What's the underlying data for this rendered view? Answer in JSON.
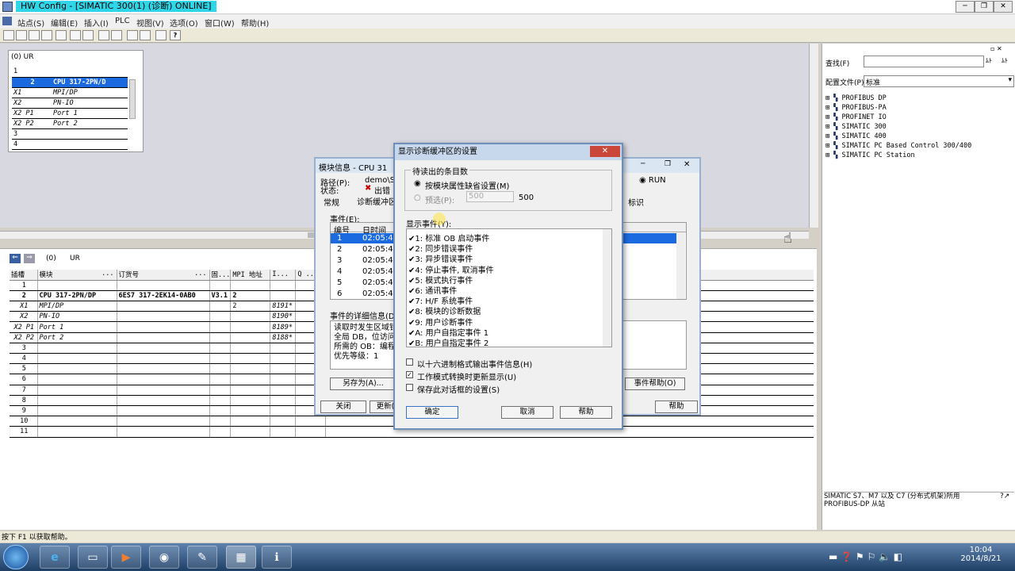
{
  "window": {
    "title": "HW Config - [SIMATIC 300(1) (诊断)  ONLINE]",
    "min": "─",
    "max": "❐",
    "close": "✕"
  },
  "menu": [
    "站点(S)",
    "编辑(E)",
    "插入(I)",
    "PLC",
    "视图(V)",
    "选项(O)",
    "窗口(W)",
    "帮助(H)"
  ],
  "rack": {
    "title": "(0)  UR",
    "rows": [
      [
        "1",
        ""
      ],
      [
        "2",
        "CPU 317-2PN/D"
      ],
      [
        "X1",
        "MPI/DP"
      ],
      [
        "X2",
        "PN-IO"
      ],
      [
        "X2 P1",
        "Port 1"
      ],
      [
        "X2 P2",
        "Port 2"
      ],
      [
        "3",
        ""
      ],
      [
        "4",
        ""
      ]
    ]
  },
  "lower": {
    "rack_label": "(0)",
    "rack_name": "UR",
    "headers": [
      "插槽",
      "模块",
      "...",
      "订货号",
      "...",
      "固...",
      "MPI 地址",
      "I...",
      "Q ..."
    ],
    "rows": [
      [
        "1",
        "",
        "",
        "",
        " ",
        "",
        ""
      ],
      [
        "2",
        "CPU 317-2PN/DP",
        "6ES7 317-2EK14-0AB0",
        "V3.1",
        "2",
        "",
        ""
      ],
      [
        "X1",
        "MPI/DP",
        "",
        "",
        "2",
        "8191*",
        ""
      ],
      [
        "X2",
        "PN-IO",
        "",
        "",
        "",
        "8190*",
        ""
      ],
      [
        "X2 P1",
        "Port 1",
        "",
        "",
        "",
        "8189*",
        ""
      ],
      [
        "X2 P2",
        "Port 2",
        "",
        "",
        "",
        "8188*",
        ""
      ],
      [
        "3",
        "",
        "",
        "",
        "",
        "",
        ""
      ],
      [
        "4",
        "",
        "",
        "",
        "",
        "",
        ""
      ],
      [
        "5",
        "",
        "",
        "",
        "",
        "",
        ""
      ],
      [
        "6",
        "",
        "",
        "",
        "",
        "",
        ""
      ],
      [
        "7",
        "",
        "",
        "",
        "",
        "",
        ""
      ],
      [
        "8",
        "",
        "",
        "",
        "",
        "",
        ""
      ],
      [
        "9",
        "",
        "",
        "",
        "",
        "",
        ""
      ],
      [
        "10",
        "",
        "",
        "",
        "",
        "",
        ""
      ],
      [
        "11",
        "",
        "",
        "",
        "",
        "",
        ""
      ]
    ]
  },
  "catalog": {
    "search_label": "查找(F)",
    "profile_label": "配置文件(P)",
    "profile_value": "标准",
    "tree": [
      "PROFIBUS DP",
      "PROFIBUS-PA",
      "PROFINET IO",
      "SIMATIC 300",
      "SIMATIC 400",
      "SIMATIC PC Based Control 300/400",
      "SIMATIC PC Station"
    ],
    "info": "SIMATIC S7、M7 以及 C7 (分布式机架)所用 PROFIBUS-DP 从站",
    "find_btn1": "ﾑﾄ",
    "find_btn2": "ﾑﾄ"
  },
  "module_info": {
    "title": "模块信息 - CPU 31",
    "path_label": "路径(P):",
    "path_value": "demo\\S",
    "status_label": "状态:",
    "status_value": "出错",
    "run": "RUN",
    "tabs": {
      "general": "常规",
      "diag": "诊断缓冲区",
      "id": "标识"
    },
    "events_label": "事件(E):",
    "col_no": "编号",
    "col_time": "日时间",
    "events": [
      [
        "1",
        "02:05:4"
      ],
      [
        "2",
        "02:05:4"
      ],
      [
        "3",
        "02:05:4"
      ],
      [
        "4",
        "02:05:4"
      ],
      [
        "5",
        "02:05:4"
      ],
      [
        "6",
        "02:05:4"
      ]
    ],
    "detail_label": "事件的详细信息(D",
    "detail_text": [
      "读取时发生区域错",
      "全局 DB，位访问",
      "所需的 OB：编程",
      "优先等级：1"
    ],
    "save_as": "另存为(A)...",
    "event_help": "事件帮助(O)",
    "close": "关闭",
    "update": "更新(",
    "help": "帮助"
  },
  "dialog": {
    "title": "显示诊断缓冲区的设置",
    "group_label": "待读出的条目数",
    "opt_default": "按模块属性缺省设置(M)",
    "opt_preset": "预选(P):",
    "preset_value": "500",
    "max_value": "500",
    "events_label": "显示事件(Y):",
    "events": [
      "1: 标准 OB 启动事件",
      "2: 同步错误事件",
      "3: 异步错误事件",
      "4: 停止事件, 取消事件",
      "5: 模式执行事件",
      "6: 通讯事件",
      "7: H/F 系统事件",
      "8: 模块的诊断数据",
      "9: 用户诊断事件",
      "A: 用户自指定事件 1",
      "B: 用户自指定事件 2"
    ],
    "hex": "以十六进制格式输出事件信息(H)",
    "refresh": "工作模式转换时更新显示(U)",
    "save": "保存此对话框的设置(S)",
    "ok": "确定",
    "cancel": "取消",
    "help": "帮助"
  },
  "status_bar": "按下 F1 以获取帮助。",
  "taskbar": {
    "time": "10:04",
    "date": "2014/8/21"
  }
}
